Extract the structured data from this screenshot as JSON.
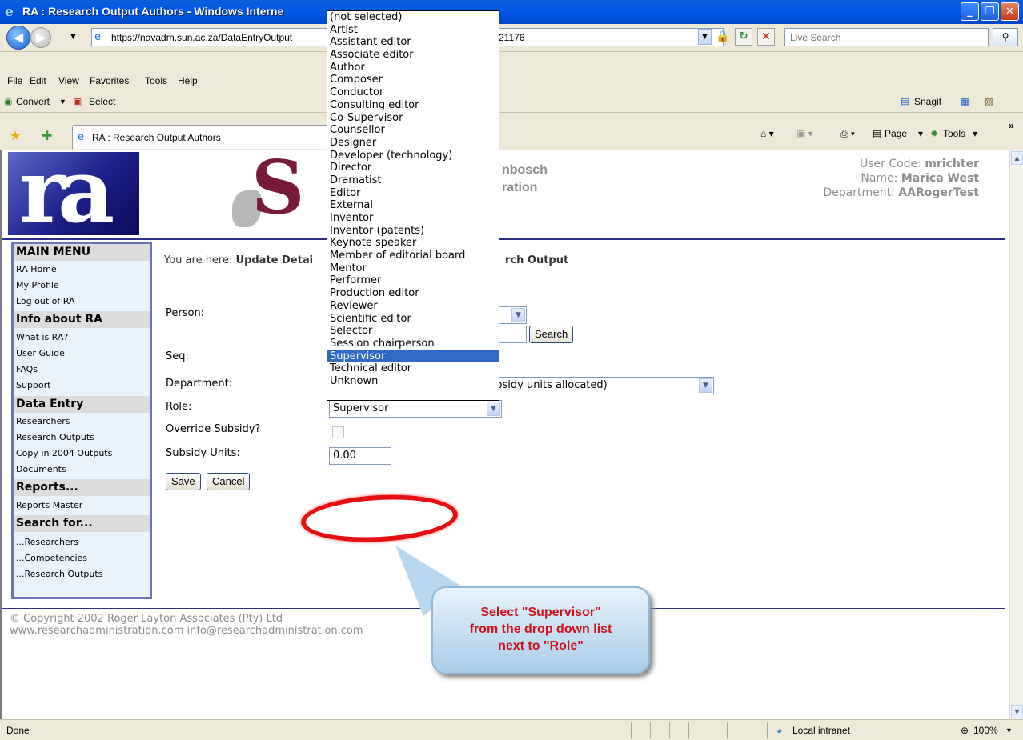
{
  "window": {
    "title": "RA : Research Output Authors - Windows Interne",
    "ie_logo": "e",
    "min_label": "_",
    "max_label": "❐",
    "close_label": "✕"
  },
  "address": {
    "url_visible": "https://navadm.sun.ac.za/DataEntryOutput",
    "url_tail": "21176",
    "search_placeholder": "Live Search",
    "search_icon": "⚲"
  },
  "menu": [
    "File",
    "Edit",
    "View",
    "Favorites",
    "Tools",
    "Help"
  ],
  "toolbar": {
    "convert_label": "Convert",
    "select_label": "Select",
    "snagit_label": "Snagit"
  },
  "tab": {
    "title": "RA : Research Output Authors"
  },
  "commands": {
    "page_label": "Page",
    "tools_label": "Tools"
  },
  "header": {
    "logo_ra": "ra",
    "logo_su": "S",
    "org_line1": "nbosch",
    "org_line2": "ration",
    "user_code_label": "User Code:",
    "user_code": "mrichter",
    "name_label": "Name:",
    "name": "Marica West",
    "department_label": "Department:",
    "department": "AARogerTest"
  },
  "sidebar": {
    "main_menu": "MAIN MENU",
    "main_items": [
      "RA Home",
      "My Profile",
      "Log out of RA"
    ],
    "info_head": "Info about RA",
    "info_items": [
      "What is RA?",
      "User Guide",
      "FAQs",
      "Support"
    ],
    "data_head": "Data Entry",
    "data_items": [
      "Researchers",
      "Research Outputs",
      "Copy in 2004 Outputs",
      "Documents"
    ],
    "reports_head": "Reports...",
    "reports_items": [
      "Reports Master"
    ],
    "search_head": "Search for...",
    "search_items": [
      "...Researchers",
      "...Competencies",
      "...Research Outputs"
    ]
  },
  "form": {
    "breadcrumb_prefix": "You are here: ",
    "breadcrumb_bold": "Update Detai",
    "breadcrumb_tail": "rch Output",
    "person_label": "Person:",
    "search_button": "Search",
    "seq_label": "Seq:",
    "department_label": "Department:",
    "department_value": "ubsidy units allocated)",
    "role_label": "Role:",
    "role_value": "Supervisor",
    "override_label": "Override Subsidy?",
    "subsidy_label": "Subsidy Units:",
    "subsidy_value": "0.00",
    "save_button": "Save",
    "cancel_button": "Cancel"
  },
  "role_options": [
    "(not selected)",
    "Artist",
    "Assistant editor",
    "Associate editor",
    "Author",
    "Composer",
    "Conductor",
    "Consulting editor",
    "Co-Supervisor",
    "Counsellor",
    "Designer",
    "Developer (technology)",
    "Director",
    "Dramatist",
    "Editor",
    "External",
    "Inventor",
    "Inventor (patents)",
    "Keynote speaker",
    "Member of editorial board",
    "Mentor",
    "Performer",
    "Production editor",
    "Reviewer",
    "Scientific editor",
    "Selector",
    "Session chairperson",
    "Supervisor",
    "Technical editor",
    "Unknown"
  ],
  "role_selected_index": 27,
  "annotation": {
    "line1": "Select \"Supervisor\"",
    "line2": "from the drop down list",
    "line3": "next to \"Role\""
  },
  "footer": {
    "copyright": "© Copyright 2002 Roger Layton Associates (Pty) Ltd",
    "links": "www.researchadministration.com    info@researchadministration.com"
  },
  "status": {
    "left": "Done",
    "zone": "Local intranet",
    "zoom": "100%"
  },
  "colors": {
    "titlebar": "#0058e6",
    "selection": "#316ac5",
    "annotation_red": "#e41010",
    "sidebar_border": "#6a74b8"
  }
}
